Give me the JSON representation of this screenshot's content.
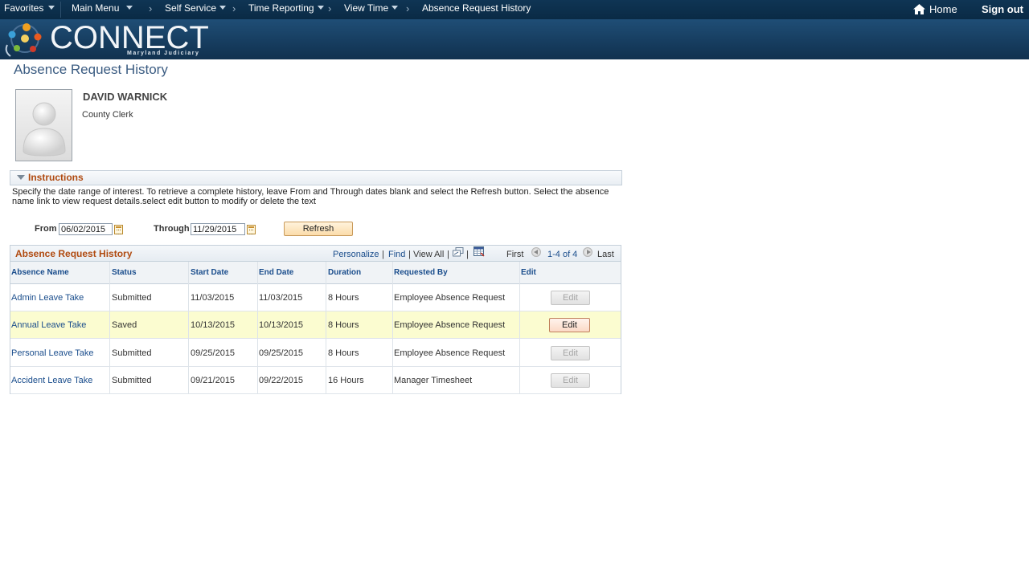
{
  "nav": {
    "favorites": "Favorites",
    "main_menu": "Main Menu",
    "self_service": "Self Service",
    "time_reporting": "Time Reporting",
    "view_time": "View Time",
    "current": "Absence Request History",
    "home": "Home",
    "sign_out": "Sign out"
  },
  "brand": {
    "name": "CONNECT",
    "subtitle": "Maryland Judiciary"
  },
  "page": {
    "title": "Absence Request History"
  },
  "employee": {
    "name": "DAVID WARNICK",
    "title": "County Clerk"
  },
  "instructions": {
    "header": "Instructions",
    "text": "Specify the date range of interest. To retrieve a complete history, leave From and Through dates blank and select the Refresh button. Select the absence name link to view request details.select edit button to modify or delete the text"
  },
  "filters": {
    "from_label": "From",
    "from_value": "06/02/2015",
    "through_label": "Through",
    "through_value": "11/29/2015",
    "refresh_label": "Refresh"
  },
  "grid": {
    "title": "Absence Request History",
    "personalize": "Personalize",
    "find": "Find",
    "view_all": "View All",
    "pipe": "|",
    "first": "First",
    "range": "1-4 of 4",
    "last": "Last",
    "columns": [
      "Absence Name",
      "Status",
      "Start Date",
      "End Date",
      "Duration",
      "Requested By",
      "Edit"
    ],
    "rows": [
      {
        "name": "Admin Leave Take",
        "status": "Submitted",
        "start": "11/03/2015",
        "end": "11/03/2015",
        "duration": "8 Hours",
        "requested_by": "Employee Absence Request",
        "edit": "Edit",
        "edit_enabled": false
      },
      {
        "name": "Annual Leave Take",
        "status": "Saved",
        "start": "10/13/2015",
        "end": "10/13/2015",
        "duration": "8 Hours",
        "requested_by": "Employee Absence Request",
        "edit": "Edit",
        "edit_enabled": true
      },
      {
        "name": "Personal Leave Take",
        "status": "Submitted",
        "start": "09/25/2015",
        "end": "09/25/2015",
        "duration": "8 Hours",
        "requested_by": "Employee Absence Request",
        "edit": "Edit",
        "edit_enabled": false
      },
      {
        "name": "Accident Leave Take",
        "status": "Submitted",
        "start": "09/21/2015",
        "end": "09/22/2015",
        "duration": "16 Hours",
        "requested_by": "Manager Timesheet",
        "edit": "Edit",
        "edit_enabled": false
      }
    ]
  },
  "colors": {
    "nav_bg": "#0f3554",
    "section_title": "#b04a10",
    "link": "#1a4d8c",
    "selected_row": "#fbfcd0"
  }
}
